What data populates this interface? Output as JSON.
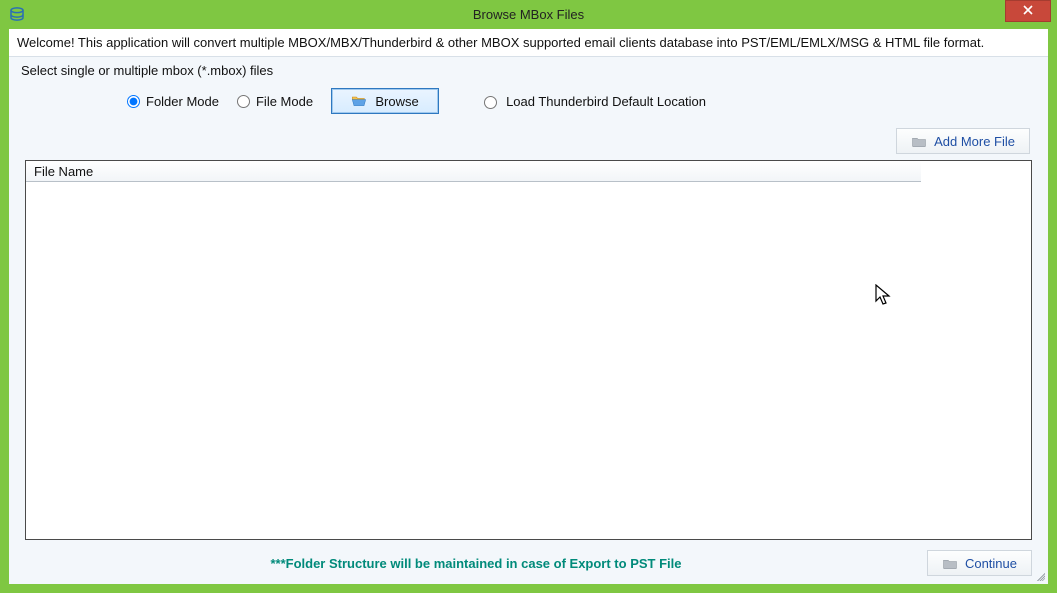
{
  "window": {
    "title": "Browse MBox Files"
  },
  "welcome_text": "Welcome! This application will convert multiple MBOX/MBX/Thunderbird & other MBOX supported email clients database into PST/EML/EMLX/MSG & HTML file format.",
  "group_title": "Select single or multiple mbox (*.mbox) files",
  "options": {
    "folder_mode_label": "Folder Mode",
    "file_mode_label": "File Mode",
    "browse_label": "Browse",
    "load_default_label": "Load Thunderbird Default Location",
    "selected": "folder_mode"
  },
  "buttons": {
    "add_more_label": "Add More File",
    "continue_label": "Continue"
  },
  "grid": {
    "columns": [
      "File Name"
    ],
    "rows": []
  },
  "footer_note": "***Folder Structure will be maintained in case of Export to PST File"
}
